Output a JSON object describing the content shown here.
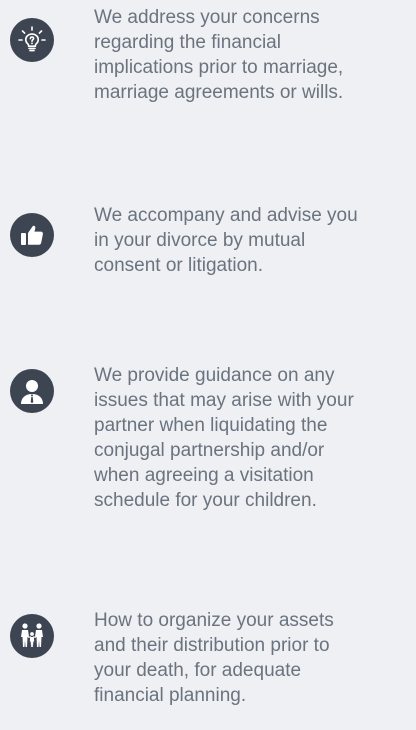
{
  "items": [
    {
      "icon": "lightbulb-idea-icon",
      "text": "We address your concerns\nregarding the financial\nimplications prior to marriage,\nmarriage agreements or wills."
    },
    {
      "icon": "thumbs-up-icon",
      "text": "We accompany and advise you\nin your divorce by mutual\nconsent or litigation."
    },
    {
      "icon": "person-icon",
      "text": "We provide guidance on any\nissues that may arise with your\npartner when liquidating the\nconjugal partnership and/or\nwhen agreeing a visitation\nschedule for your children."
    },
    {
      "icon": "family-icon",
      "text": "How to organize your assets\nand their distribution prior to\nyour death, for adequate\nfinancial planning."
    }
  ],
  "colors": {
    "background": "#eef0f3",
    "icon_circle": "#3e4552",
    "text": "#6b737f"
  }
}
